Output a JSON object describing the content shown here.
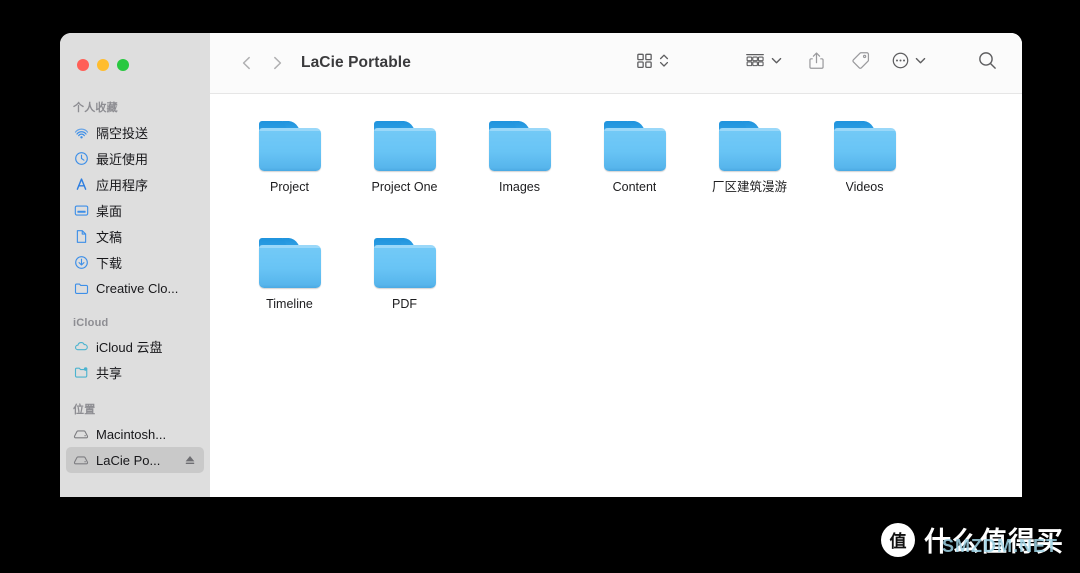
{
  "window": {
    "title": "LaCie Portable",
    "traffic_lights": {
      "close": "close-button",
      "minimize": "minimize-button",
      "maximize": "maximize-button"
    }
  },
  "toolbar": {
    "back_label": "‹",
    "forward_label": "›",
    "breadcrumb": "LaCie Portable",
    "view_icon": "grid-view-icon",
    "view_stepper_icon": "up-down-chevron-icon",
    "group_icon": "group-by-icon",
    "group_chevron": "chevron-down-icon",
    "share_icon": "share-icon",
    "tag_icon": "tag-icon",
    "more_icon": "ellipsis-circle-icon",
    "more_chevron": "chevron-down-icon",
    "search_icon": "search-icon"
  },
  "sidebar": {
    "sections": [
      {
        "title": "个人收藏",
        "items": [
          {
            "label": "隔空投送",
            "icon": "airdrop-icon"
          },
          {
            "label": "最近使用",
            "icon": "clock-icon"
          },
          {
            "label": "应用程序",
            "icon": "applications-icon"
          },
          {
            "label": "桌面",
            "icon": "desktop-icon"
          },
          {
            "label": "文稿",
            "icon": "document-icon"
          },
          {
            "label": "下载",
            "icon": "downloads-icon"
          },
          {
            "label": "Creative Clo...",
            "icon": "folder-icon"
          }
        ]
      },
      {
        "title": "iCloud",
        "items": [
          {
            "label": "iCloud 云盘",
            "icon": "cloud-icon"
          },
          {
            "label": "共享",
            "icon": "shared-folder-icon"
          }
        ]
      },
      {
        "title": "位置",
        "items": [
          {
            "label": "Macintosh...",
            "icon": "hard-disk-icon",
            "selected": false
          },
          {
            "label": "LaCie Po...",
            "icon": "hard-disk-icon",
            "selected": true,
            "eject": "eject-icon"
          }
        ]
      }
    ]
  },
  "content": {
    "items": [
      {
        "name": "Project",
        "type": "folder"
      },
      {
        "name": "Project One",
        "type": "folder"
      },
      {
        "name": "Images",
        "type": "folder"
      },
      {
        "name": "Content",
        "type": "folder"
      },
      {
        "name": "厂区建筑漫游",
        "type": "folder"
      },
      {
        "name": "Videos",
        "type": "folder"
      },
      {
        "name": "Timeline",
        "type": "folder"
      },
      {
        "name": "PDF",
        "type": "folder"
      }
    ]
  },
  "watermark": {
    "mark": "值",
    "brand": "什么值得买",
    "site": "SMZDM.NET"
  },
  "colors": {
    "sidebar_bg": "#dedede",
    "sidebar_selected": "#c9c9c9",
    "toolbar_bg": "#fbfbfb",
    "content_bg": "#ffffff",
    "folder_blue": "#68c4f5",
    "folder_tab_blue": "#1f93dd",
    "accent_blue": "#2f7fe0",
    "page_bg": "#000000"
  }
}
